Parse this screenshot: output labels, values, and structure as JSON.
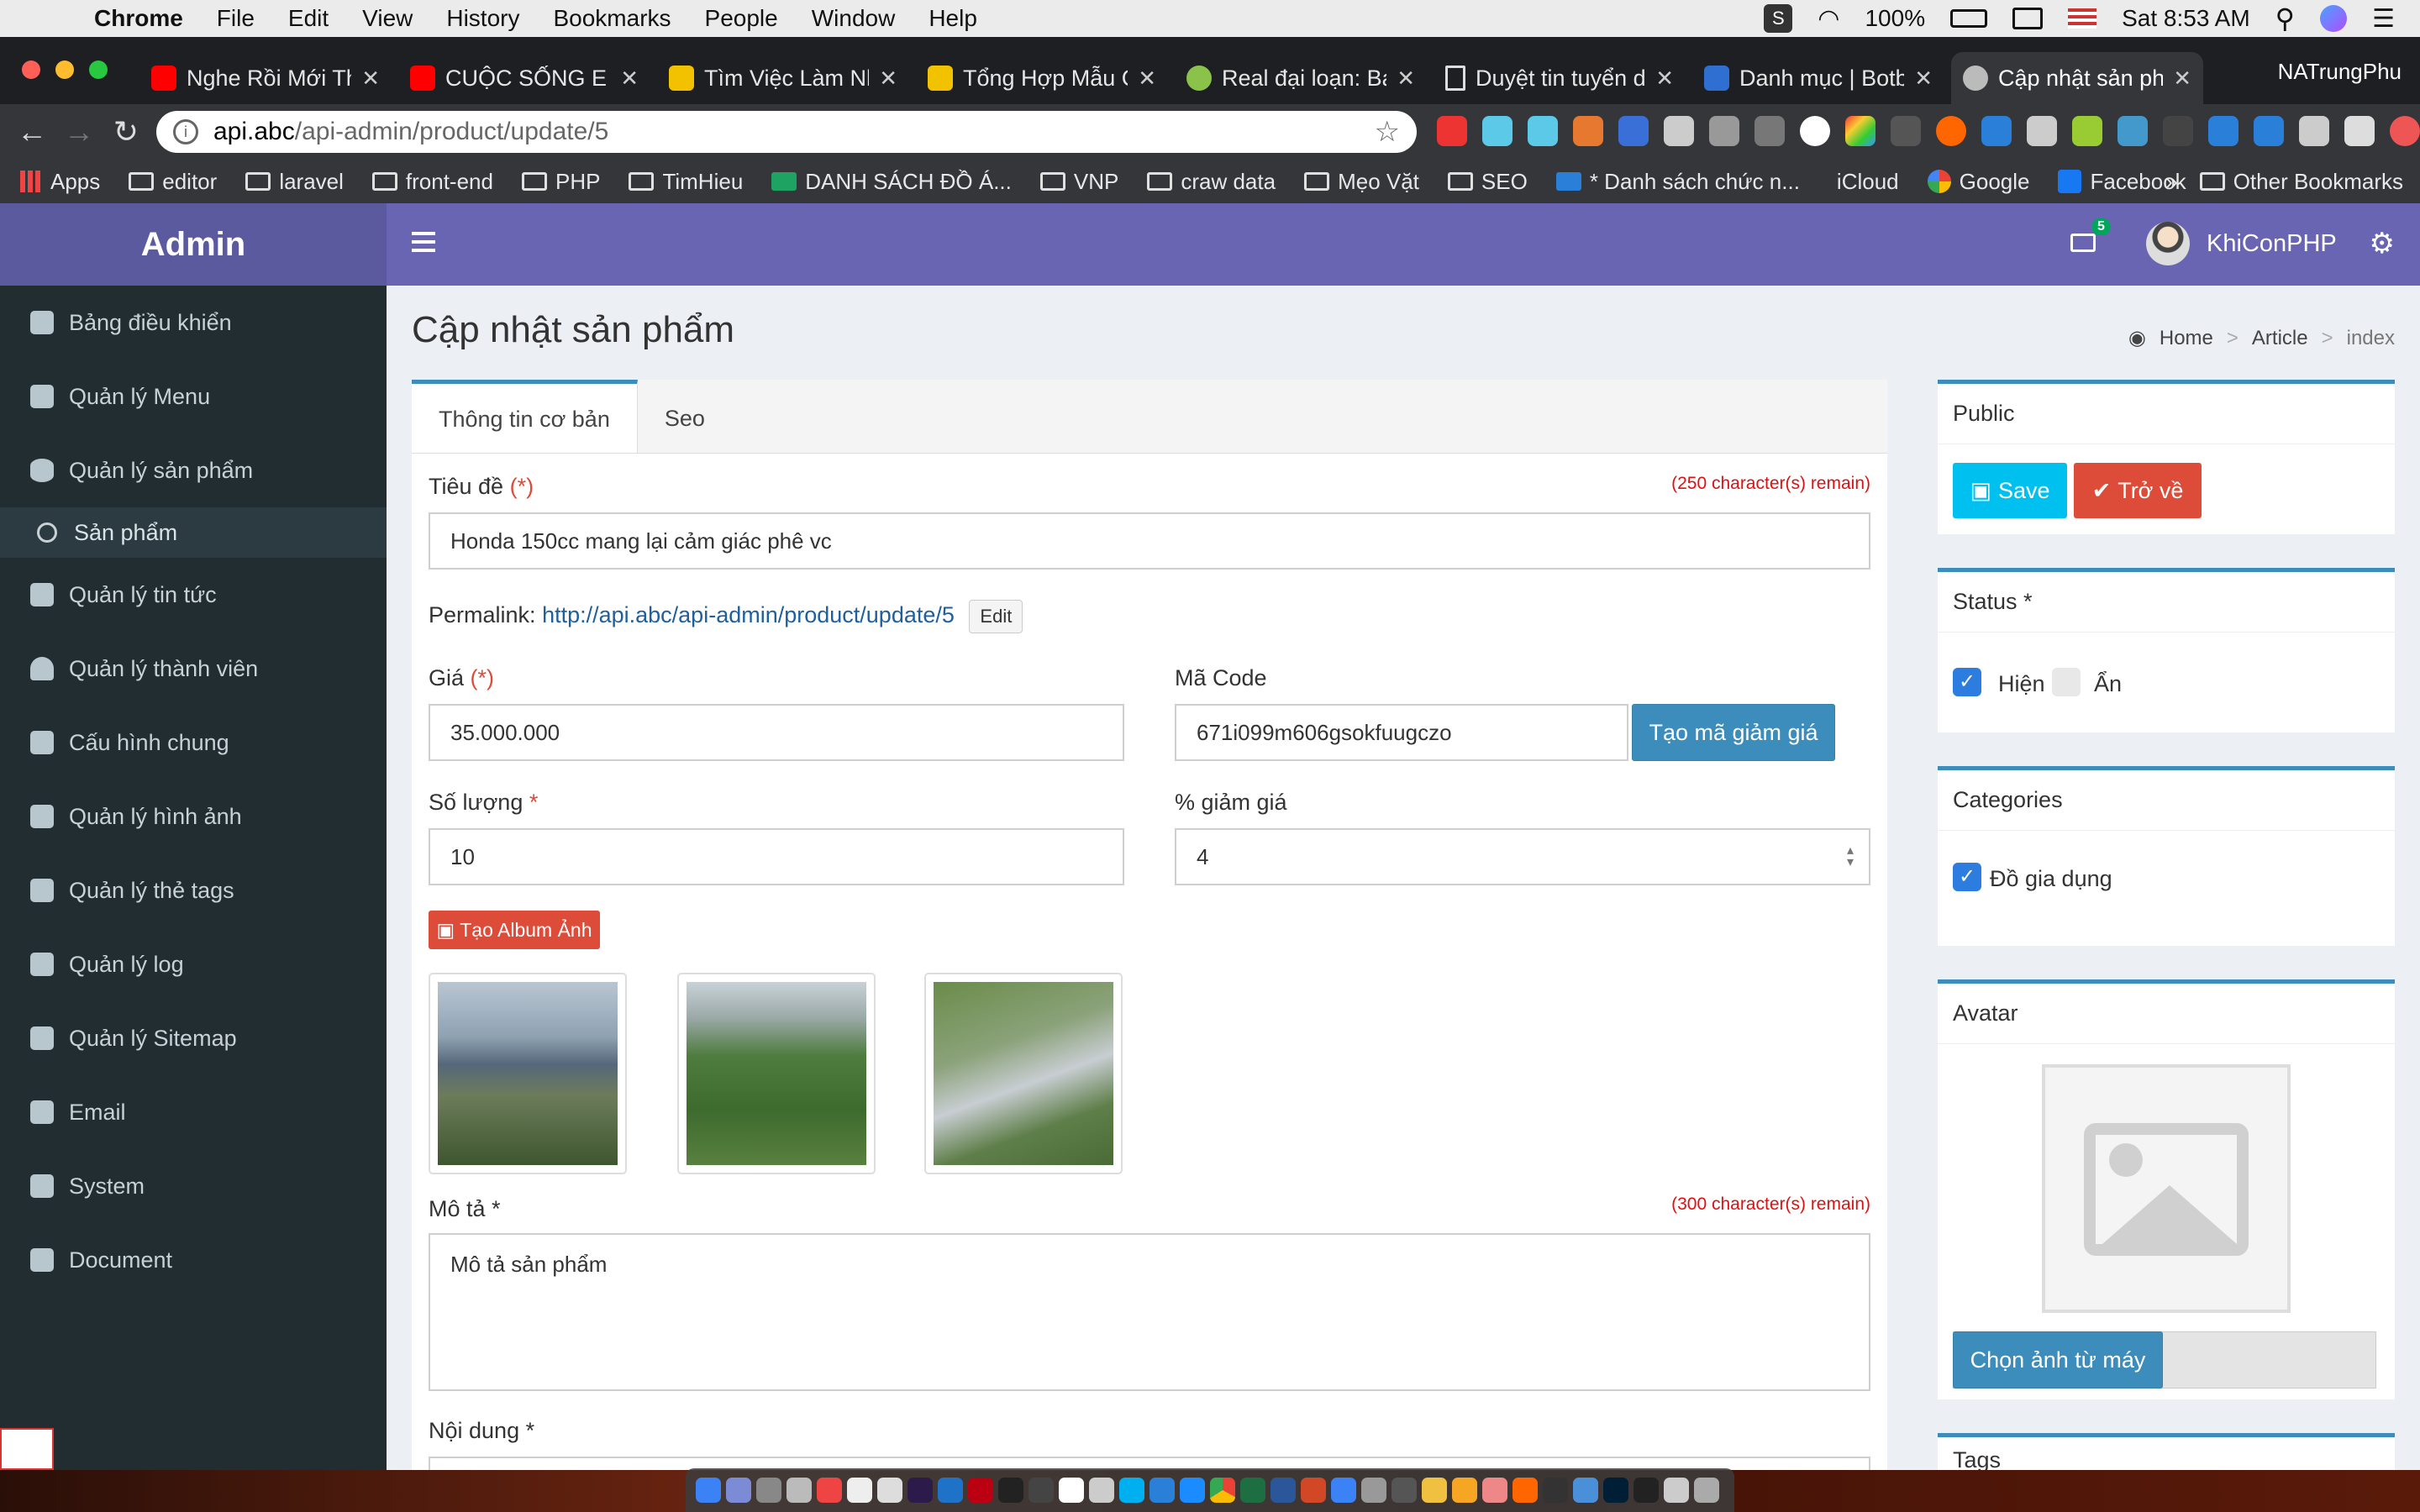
{
  "mac_menubar": {
    "app": "Chrome",
    "menus": [
      "File",
      "Edit",
      "View",
      "History",
      "Bookmarks",
      "People",
      "Window",
      "Help"
    ],
    "battery": "100%",
    "clock": "Sat 8:53 AM"
  },
  "browser": {
    "tabs": [
      {
        "title": "Nghe Rồi Mới Thấ",
        "favicon": "youtube-icon",
        "color": "#ff0000"
      },
      {
        "title": "CUỘC SỐNG E",
        "favicon": "youtube-icon",
        "color": "#ff0000"
      },
      {
        "title": "Tìm Việc Làm Nh",
        "favicon": "job-icon",
        "color": "#f2c200"
      },
      {
        "title": "Tổng Hợp Mẫu C",
        "favicon": "job-icon",
        "color": "#f2c200"
      },
      {
        "title": "Real đại loạn: Bal",
        "favicon": "clock-icon",
        "color": "#8bc34a"
      },
      {
        "title": "Duyệt tin tuyển d",
        "favicon": "document-icon",
        "color": "#ffffff"
      },
      {
        "title": "Danh mục | Botbl",
        "favicon": "b-icon",
        "color": "#2f6fd1"
      },
      {
        "title": "Cập nhật sản phẩ",
        "favicon": "site-icon",
        "color": "#bbbbbb",
        "active": true
      }
    ],
    "profile": "NATrungPhu",
    "url_host": "api.abc",
    "url_path": "/api-admin/product/update/5",
    "bookmarks": [
      "Apps",
      "editor",
      "laravel",
      "front-end",
      "PHP",
      "TimHieu",
      "DANH SÁCH ĐỒ Á...",
      "VNP",
      "craw data",
      "Mẹo Vặt",
      "SEO",
      "* Danh sách chức n...",
      "iCloud",
      "Google",
      "Facebook"
    ],
    "other_bookmarks": "Other Bookmarks",
    "more": "»"
  },
  "header": {
    "brand": "Admin",
    "mail_count": "5",
    "username": "KhiConPHP"
  },
  "sidebar": {
    "items": [
      {
        "label": "Bảng điều khiển",
        "icon": "dashboard-icon"
      },
      {
        "label": "Quản lý Menu",
        "icon": "edit-icon"
      },
      {
        "label": "Quản lý sản phẩm",
        "icon": "database-icon"
      },
      {
        "label": "Sản phẩm",
        "icon": "circle-icon",
        "sub": true
      },
      {
        "label": "Quản lý tin tức",
        "icon": "edit-icon"
      },
      {
        "label": "Quản lý thành viên",
        "icon": "user-icon"
      },
      {
        "label": "Cấu hình chung",
        "icon": "building-icon"
      },
      {
        "label": "Quản lý hình ảnh",
        "icon": "image-icon"
      },
      {
        "label": "Quản lý thẻ tags",
        "icon": "tags-icon"
      },
      {
        "label": "Quản lý log",
        "icon": "warning-icon"
      },
      {
        "label": "Quản lý Sitemap",
        "icon": "sitemap-icon"
      },
      {
        "label": "Email",
        "icon": "envelope-icon"
      },
      {
        "label": "System",
        "icon": "wrench-icon"
      },
      {
        "label": "Document",
        "icon": "file-icon"
      }
    ]
  },
  "page": {
    "title": "Cập nhật sản phẩm",
    "breadcrumb": [
      "Home",
      "Article",
      "index"
    ]
  },
  "form": {
    "tabs": [
      "Thông tin cơ bản",
      "Seo"
    ],
    "title_label": "Tiêu đề",
    "required_mark": "(*)",
    "title_remain": "(250 character(s) remain)",
    "title_value": "Honda 150cc mang lại cảm giác phê vc",
    "permalink_label": "Permalink:",
    "permalink_url": "http://api.abc/api-admin/product/update/5",
    "edit_button": "Edit",
    "price_label": "Giá",
    "price_value": "35.000.000",
    "code_label": "Mã Code",
    "code_value": "671i099m606gsokfuugczo",
    "generate_code_button": "Tạo mã giảm giá",
    "quantity_label": "Số lượng",
    "star": "*",
    "quantity_value": "10",
    "discount_label": "% giảm giá",
    "discount_value": "4",
    "album_button": "Tạo Album Ảnh",
    "description_label": "Mô tả *",
    "description_remain": "(300 character(s) remain)",
    "description_value": "Mô tả sản phẩm",
    "content_label": "Nội dung *"
  },
  "right": {
    "public_title": "Public",
    "save_button": "Save",
    "back_button": "Trở về",
    "status_title": "Status *",
    "status_show": "Hiện",
    "status_hide": "Ẩn",
    "categories_title": "Categories",
    "category_1": "Đồ gia dụng",
    "avatar_title": "Avatar",
    "choose_image_button": "Chọn ảnh từ máy",
    "tags_title": "Tags"
  },
  "colors": {
    "brand": "#5c5a9e",
    "topbar": "#6965b2",
    "sidebar": "#222d32",
    "primary": "#3c8dbc",
    "danger": "#dd4b39",
    "info": "#00c0ef"
  }
}
